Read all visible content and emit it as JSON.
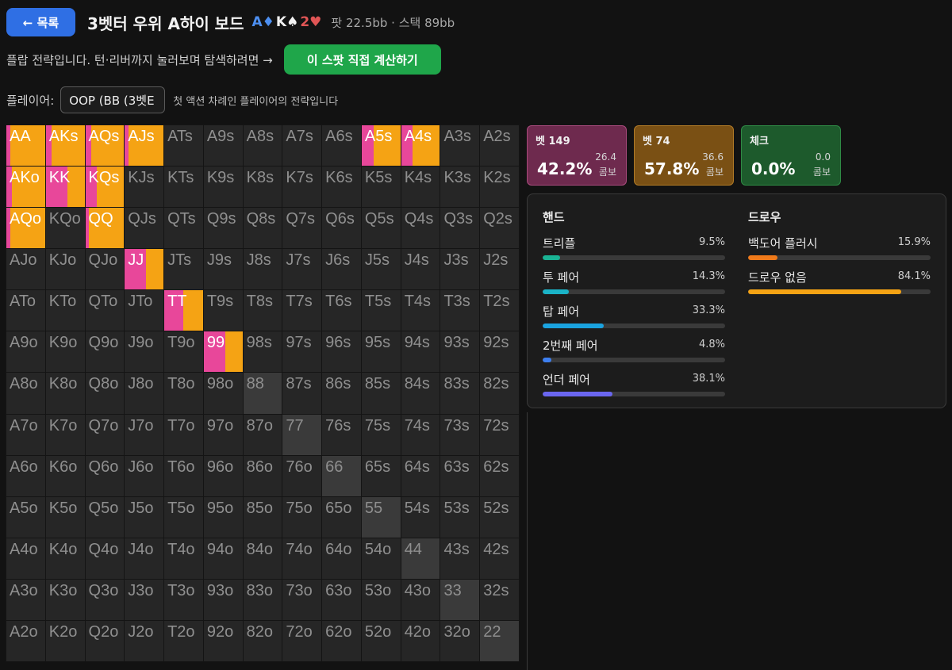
{
  "header": {
    "back_label": "← 목록",
    "title": "3벳터 우위 A하이 보드",
    "board": [
      {
        "rank": "A",
        "suit": "♦",
        "color": "#4d8ff0"
      },
      {
        "rank": "K",
        "suit": "♠",
        "color": "#f2f2f2"
      },
      {
        "rank": "2",
        "suit": "♥",
        "color": "#e05555"
      }
    ],
    "pot_info": "팟 22.5bb · 스택 89bb"
  },
  "subline": {
    "text": "플랍 전략입니다. 턴·리버까지 눌러보며 탐색하려면 →",
    "calc_label": "이 스팟 직접 계산하기"
  },
  "player": {
    "label": "플레이어:",
    "selected": "OOP (BB (3벳E",
    "note": "첫 액션 차례인 플레이어의 전략입니다"
  },
  "colors": {
    "bet149": "#e8479a",
    "bet74": "#f5a314",
    "check": "#27a84a"
  },
  "actions": [
    {
      "name": "벳 149",
      "pct": "42.2%",
      "combos": "26.4",
      "combo_label": "콤보",
      "bg": "#6e2a4e",
      "border": "#a84a7c"
    },
    {
      "name": "벳 74",
      "pct": "57.8%",
      "combos": "36.6",
      "combo_label": "콤보",
      "bg": "#7a5014",
      "border": "#b07a26"
    },
    {
      "name": "체크",
      "pct": "0.0%",
      "combos": "0.0",
      "combo_label": "콤보",
      "bg": "#1d5a2c",
      "border": "#2f8a45"
    }
  ],
  "hands": {
    "title": "핸드",
    "items": [
      {
        "name": "트리플",
        "value": "9.5%",
        "fraction": 0.095,
        "color": "#1ab394"
      },
      {
        "name": "투 페어",
        "value": "14.3%",
        "fraction": 0.143,
        "color": "#1ab3c7"
      },
      {
        "name": "탑 페어",
        "value": "33.3%",
        "fraction": 0.333,
        "color": "#1aa3e0"
      },
      {
        "name": "2번째 페어",
        "value": "4.8%",
        "fraction": 0.048,
        "color": "#3d7ff0"
      },
      {
        "name": "언더 페어",
        "value": "38.1%",
        "fraction": 0.381,
        "color": "#6a66f0"
      }
    ]
  },
  "draws": {
    "title": "드로우",
    "items": [
      {
        "name": "백도어 플러시",
        "value": "15.9%",
        "fraction": 0.159,
        "color": "#f07a1a"
      },
      {
        "name": "드로우 없음",
        "value": "84.1%",
        "fraction": 0.841,
        "color": "#f5a314"
      }
    ]
  },
  "matrix": {
    "labels": [
      [
        "AA",
        "AKs",
        "AQs",
        "AJs",
        "ATs",
        "A9s",
        "A8s",
        "A7s",
        "A6s",
        "A5s",
        "A4s",
        "A3s",
        "A2s"
      ],
      [
        "AKo",
        "KK",
        "KQs",
        "KJs",
        "KTs",
        "K9s",
        "K8s",
        "K7s",
        "K6s",
        "K5s",
        "K4s",
        "K3s",
        "K2s"
      ],
      [
        "AQo",
        "KQo",
        "QQ",
        "QJs",
        "QTs",
        "Q9s",
        "Q8s",
        "Q7s",
        "Q6s",
        "Q5s",
        "Q4s",
        "Q3s",
        "Q2s"
      ],
      [
        "AJo",
        "KJo",
        "QJo",
        "JJ",
        "JTs",
        "J9s",
        "J8s",
        "J7s",
        "J6s",
        "J5s",
        "J4s",
        "J3s",
        "J2s"
      ],
      [
        "ATo",
        "KTo",
        "QTo",
        "JTo",
        "TT",
        "T9s",
        "T8s",
        "T7s",
        "T6s",
        "T5s",
        "T4s",
        "T3s",
        "T2s"
      ],
      [
        "A9o",
        "K9o",
        "Q9o",
        "J9o",
        "T9o",
        "99",
        "98s",
        "97s",
        "96s",
        "95s",
        "94s",
        "93s",
        "92s"
      ],
      [
        "A8o",
        "K8o",
        "Q8o",
        "J8o",
        "T8o",
        "98o",
        "88",
        "87s",
        "86s",
        "85s",
        "84s",
        "83s",
        "82s"
      ],
      [
        "A7o",
        "K7o",
        "Q7o",
        "J7o",
        "T7o",
        "97o",
        "87o",
        "77",
        "76s",
        "75s",
        "74s",
        "73s",
        "72s"
      ],
      [
        "A6o",
        "K6o",
        "Q6o",
        "J6o",
        "T6o",
        "96o",
        "86o",
        "76o",
        "66",
        "65s",
        "64s",
        "63s",
        "62s"
      ],
      [
        "A5o",
        "K5o",
        "Q5o",
        "J5o",
        "T5o",
        "95o",
        "85o",
        "75o",
        "65o",
        "55",
        "54s",
        "53s",
        "52s"
      ],
      [
        "A4o",
        "K4o",
        "Q4o",
        "J4o",
        "T4o",
        "94o",
        "84o",
        "74o",
        "64o",
        "54o",
        "44",
        "43s",
        "42s"
      ],
      [
        "A3o",
        "K3o",
        "Q3o",
        "J3o",
        "T3o",
        "93o",
        "83o",
        "73o",
        "63o",
        "53o",
        "43o",
        "33",
        "32s"
      ],
      [
        "A2o",
        "K2o",
        "Q2o",
        "J2o",
        "T2o",
        "92o",
        "82o",
        "72o",
        "62o",
        "52o",
        "42o",
        "32o",
        "22"
      ]
    ],
    "strategies": {
      "AA": [
        0.1,
        0.9
      ],
      "AKs": [
        0.15,
        0.85
      ],
      "AQs": [
        0.15,
        0.85
      ],
      "AJs": [
        0.1,
        0.9
      ],
      "A5s": [
        0.3,
        0.7
      ],
      "A4s": [
        0.3,
        0.7
      ],
      "AKo": [
        0.15,
        0.85
      ],
      "KK": [
        0.55,
        0.45
      ],
      "KQs": [
        0.3,
        0.7
      ],
      "AQo": [
        0.1,
        0.9
      ],
      "QQ": [
        0.1,
        0.9
      ],
      "JJ": [
        0.55,
        0.45
      ],
      "TT": [
        0.5,
        0.5
      ],
      "99": [
        0.55,
        0.45
      ]
    },
    "unreached_pairs": [
      "88",
      "77",
      "66",
      "55",
      "44",
      "33",
      "22"
    ]
  }
}
